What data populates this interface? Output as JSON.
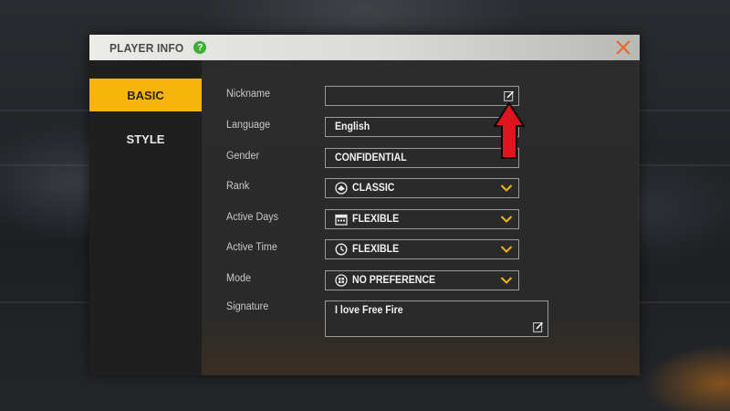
{
  "window": {
    "title": "PLAYER INFO",
    "help_icon": "?",
    "close_icon": "close-icon"
  },
  "sidebar": {
    "tabs": [
      {
        "label": "BASIC",
        "active": true
      },
      {
        "label": "STYLE",
        "active": false
      }
    ]
  },
  "form": {
    "nickname": {
      "label": "Nickname",
      "value": ""
    },
    "language": {
      "label": "Language",
      "value": "English"
    },
    "gender": {
      "label": "Gender",
      "value": "CONFIDENTIAL"
    },
    "rank": {
      "label": "Rank",
      "value": "CLASSIC",
      "icon": "rank-icon"
    },
    "active_days": {
      "label": "Active Days",
      "value": "FLEXIBLE",
      "icon": "calendar-icon"
    },
    "active_time": {
      "label": "Active Time",
      "value": "FLEXIBLE",
      "icon": "clock-icon"
    },
    "mode": {
      "label": "Mode",
      "value": "NO PREFERENCE",
      "icon": "grid-icon"
    },
    "signature": {
      "label": "Signature",
      "value": "I love Free Fire"
    }
  },
  "colors": {
    "accent": "#f7b50c",
    "close": "#e8692a",
    "chevron": "#f2b418",
    "help": "#3fae35",
    "arrow": "#e0141e"
  }
}
